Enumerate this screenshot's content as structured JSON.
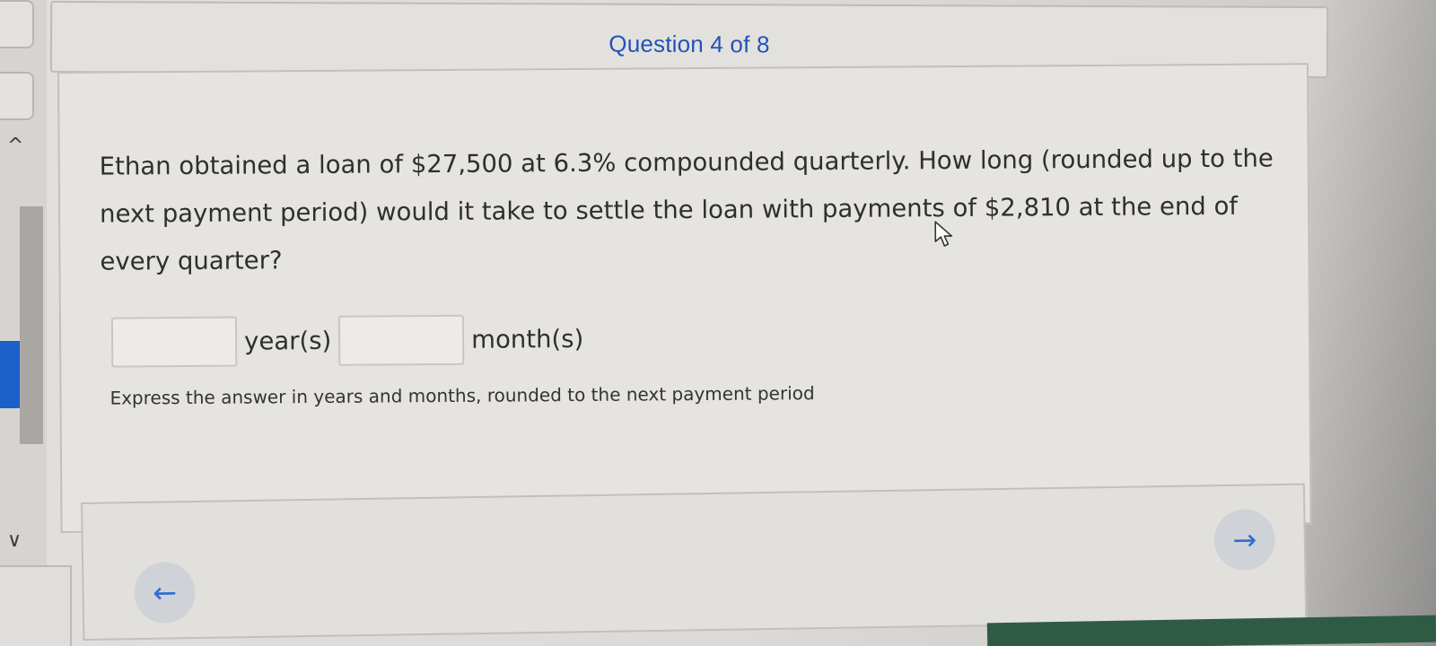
{
  "header": {
    "question_counter": "Question 4 of 8"
  },
  "question": {
    "text": "Ethan obtained a loan of $27,500 at 6.3% compounded quarterly. How long (rounded up to the next payment period) would it take to settle the loan with payments of $2,810 at the end of every quarter?"
  },
  "answer": {
    "years_value": "",
    "years_unit": "year(s)",
    "months_value": "",
    "months_unit": "month(s)",
    "hint": "Express the answer in years and months, rounded to the next payment period"
  },
  "navigation": {
    "prev_icon": "arrow-left-icon",
    "next_icon": "arrow-right-icon"
  },
  "colors": {
    "accent": "#2253b8",
    "nav_arrow": "#2f6fd1",
    "sidebar_accent": "#1b5fc9"
  }
}
